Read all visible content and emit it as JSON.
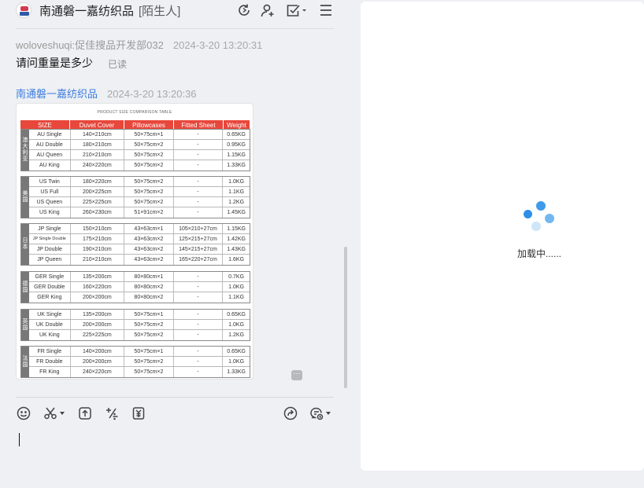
{
  "header": {
    "title": "南通磐一嘉纺织品",
    "tag": "[陌生人]"
  },
  "messages": [
    {
      "sender": "woloveshuqi:促佳搜品开发部032",
      "time": "2024-3-20 13:20:31",
      "text": "请问重量是多少",
      "status": "已读"
    },
    {
      "sender": "南通磐一嘉纺织品",
      "time": "2024-3-20 13:20:36"
    }
  ],
  "image_table": {
    "title": "PRODUCT SIZE COMPARISON TABLE",
    "headers": [
      "SIZE",
      "Duvet Cover",
      "Pillowcases",
      "Fitted Sheet",
      "Weight"
    ],
    "groups": [
      {
        "label": "澳大利亚",
        "rows": [
          [
            "AU Single",
            "140×210cm",
            "50×75cm×1",
            "-",
            "0.65KG"
          ],
          [
            "AU Double",
            "180×210cm",
            "50×75cm×2",
            "-",
            "0.95KG"
          ],
          [
            "AU Queen",
            "210×210cm",
            "50×75cm×2",
            "-",
            "1.15KG"
          ],
          [
            "AU King",
            "240×220cm",
            "50×75cm×2",
            "-",
            "1.33KG"
          ]
        ]
      },
      {
        "label": "美国",
        "rows": [
          [
            "US Twin",
            "180×220cm",
            "50×75cm×2",
            "-",
            "1.0KG"
          ],
          [
            "US Full",
            "200×225cm",
            "50×75cm×2",
            "-",
            "1.1KG"
          ],
          [
            "US Queen",
            "225×225cm",
            "50×75cm×2",
            "-",
            "1.2KG"
          ],
          [
            "US King",
            "260×230cm",
            "51×91cm×2",
            "-",
            "1.45KG"
          ]
        ]
      },
      {
        "label": "日本",
        "rows": [
          [
            "JP Single",
            "150×210cm",
            "43×63cm×1",
            "105×210+27cm",
            "1.15KG"
          ],
          [
            "JP Single Double",
            "175×210cm",
            "43×63cm×2",
            "125×215+27cm",
            "1.42KG"
          ],
          [
            "JP Double",
            "190×210cm",
            "43×63cm×2",
            "145×215+27cm",
            "1.43KG"
          ],
          [
            "JP Queen",
            "210×210cm",
            "43×63cm×2",
            "165×220+27cm",
            "1.6KG"
          ]
        ]
      },
      {
        "label": "德国",
        "rows": [
          [
            "GER Single",
            "135×200cm",
            "80×80cm×1",
            "-",
            "0.7KG"
          ],
          [
            "GER Double",
            "160×220cm",
            "80×80cm×2",
            "-",
            "1.0KG"
          ],
          [
            "GER King",
            "200×200cm",
            "80×80cm×2",
            "-",
            "1.1KG"
          ]
        ]
      },
      {
        "label": "英国",
        "rows": [
          [
            "UK Single",
            "135×200cm",
            "50×75cm×1",
            "-",
            "0.65KG"
          ],
          [
            "UK Double",
            "200×200cm",
            "50×75cm×2",
            "-",
            "1.0KG"
          ],
          [
            "UK King",
            "225×225cm",
            "50×75cm×2",
            "-",
            "1.2KG"
          ]
        ]
      },
      {
        "label": "法国",
        "rows": [
          [
            "FR Single",
            "140×200cm",
            "50×75cm×1",
            "-",
            "0.65KG"
          ],
          [
            "FR Double",
            "200×200cm",
            "50×75cm×2",
            "-",
            "1.0KG"
          ],
          [
            "FR King",
            "240×220cm",
            "50×75cm×2",
            "-",
            "1.33KG"
          ]
        ]
      }
    ]
  },
  "toolbar": {
    "icons": [
      "emoji-icon",
      "scissors-icon",
      "upload-icon",
      "calculator-icon",
      "coupon-icon",
      "share-icon",
      "quick-reply-icon"
    ]
  },
  "right_panel": {
    "loading_text": "加载中......"
  },
  "colors": {
    "accent": "#3e7de0",
    "table_header": "#e8473c",
    "spinner": "#3f9bea"
  }
}
